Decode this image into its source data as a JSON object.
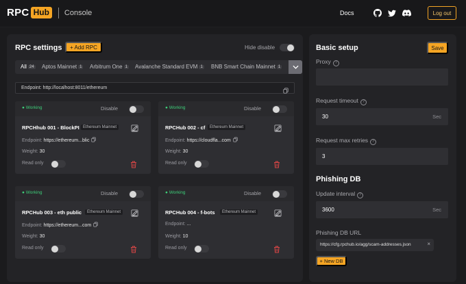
{
  "header": {
    "logo_text": "RPC",
    "logo_badge": "Hub",
    "console_label": "Console",
    "docs_label": "Docs",
    "icons": [
      "github-icon",
      "twitter-icon",
      "discord-icon"
    ],
    "logout_label": "Log out"
  },
  "rpc_settings": {
    "title": "RPC settings",
    "add_button": "+ Add RPC",
    "hide_disable_label": "Hide disable",
    "tabs": [
      {
        "label": "All",
        "count": "24"
      },
      {
        "label": "Aptos Mainnet",
        "count": "1"
      },
      {
        "label": "Arbitrum One",
        "count": "1"
      },
      {
        "label": "Avalanche Standard EVM",
        "count": "1"
      },
      {
        "label": "BNB Smart Chain Mainnet",
        "count": "1"
      }
    ],
    "endpoint_label": "Endpoint:",
    "endpoint_value": "http://localhost:8011/ethereum",
    "card_labels": {
      "status": "● Working",
      "disable": "Disable",
      "endpoint": "Endpoint:",
      "weight": "Weight:",
      "read_only": "Read only"
    },
    "cards": [
      {
        "name": "RPCHhub 001 - BlockPI",
        "chain": "Ethereum Mainnet",
        "endpoint": "https://ethereum...blic",
        "weight": "30"
      },
      {
        "name": "RPCHub 002 - cf",
        "chain": "Ethereum Mainnet",
        "endpoint": "https://cloudfla...com",
        "weight": "30"
      },
      {
        "name": "RPCHub 003 - eth public",
        "chain": "Ethereum Mainnet",
        "endpoint": "https://ethereum...com",
        "weight": "30"
      },
      {
        "name": "RPCHub 004 - f-bots",
        "chain": "Ethereum Mainnet",
        "endpoint": "...",
        "weight": "10"
      }
    ]
  },
  "basic_setup": {
    "title": "Basic setup",
    "save_label": "Save",
    "proxy_label": "Proxy",
    "proxy_value": "",
    "timeout_label": "Request timeout",
    "timeout_value": "30",
    "timeout_unit": "Sec",
    "retries_label": "Request max retries",
    "retries_value": "3"
  },
  "phishing_db": {
    "title": "Phishing DB",
    "interval_label": "Update interval",
    "interval_value": "3600",
    "interval_unit": "Sec",
    "url_label": "Phishing DB URL",
    "url_value": "https://cfg.rpchub.io/agg/scam-addresses.json",
    "new_db_label": "+ New DB"
  },
  "colors": {
    "accent": "#f5a524",
    "working": "#3ed07a",
    "delete": "#d64545"
  }
}
